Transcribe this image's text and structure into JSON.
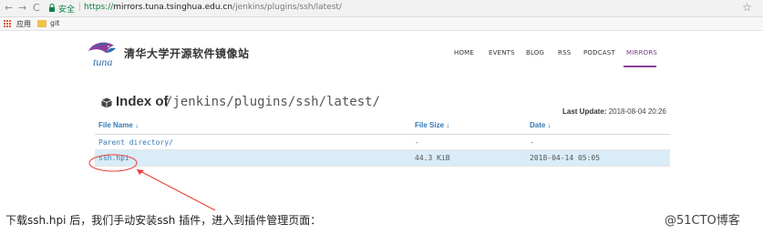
{
  "browser": {
    "back_icon": "back-arrow-icon",
    "forward_icon": "forward-arrow-icon",
    "reload_icon": "reload-icon",
    "secure_label": "安全",
    "url_scheme": "https://",
    "url_host": "mirrors.tuna.tsinghua.edu.cn",
    "url_path": "/jenkins/plugins/ssh/latest/",
    "bookmark_icon": "star-icon",
    "bookmarks": [
      {
        "label": "应用",
        "icon": "apps-grid-icon"
      },
      {
        "label": "git",
        "icon": "folder-icon"
      }
    ]
  },
  "site": {
    "logo_text": "tuna",
    "title": "清华大学开源软件镜像站",
    "nav": [
      {
        "label": "HOME",
        "active": false
      },
      {
        "label": "EVENTS",
        "active": false
      },
      {
        "label": "BLOG",
        "active": false
      },
      {
        "label": "RSS",
        "active": false
      },
      {
        "label": "PODCAST",
        "active": false
      },
      {
        "label": "MIRRORS",
        "active": true
      }
    ],
    "accent_color": "#8a3f9a"
  },
  "listing": {
    "index_label": "Index of",
    "path": "/jenkins/plugins/ssh/latest/",
    "last_update_label": "Last Update:",
    "last_update_value": "2018-08-04 20:26",
    "columns": [
      {
        "label": "File Name ↓"
      },
      {
        "label": "File Size ↓"
      },
      {
        "label": "Date ↓"
      }
    ],
    "rows": [
      {
        "name": "Parent directory/",
        "size": "-",
        "date": "-"
      },
      {
        "name": "ssh.hpi",
        "size": "44.3 KiB",
        "date": "2018-04-14 05:05"
      }
    ],
    "link_color": "#3a7ab8",
    "highlight_color": "#d9ecf7"
  },
  "annotation": {
    "caption": "下载ssh.hpi 后，我们手动安装ssh 插件，进入到插件管理页面：",
    "watermark": "@51CTO博客",
    "mark_color": "#e8433c"
  }
}
